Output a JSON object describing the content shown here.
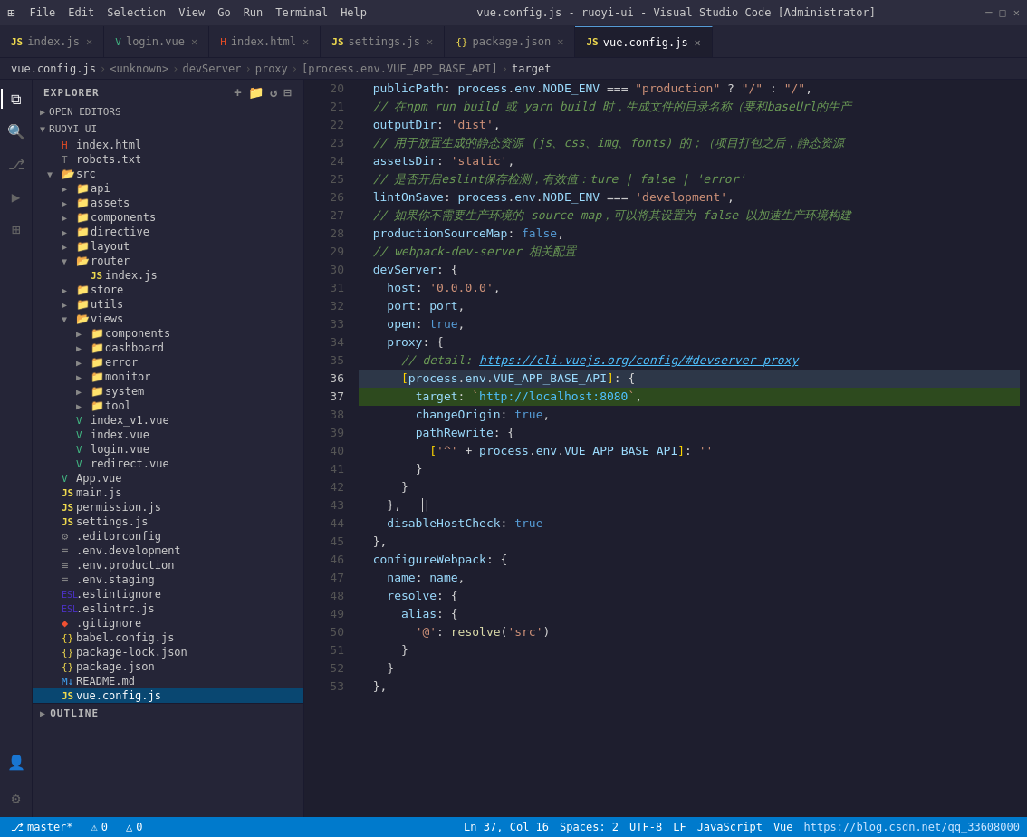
{
  "titlebar": {
    "title": "vue.config.js - ruoyi-ui - Visual Studio Code [Administrator]",
    "menus": [
      "File",
      "Edit",
      "Selection",
      "View",
      "Go",
      "Run",
      "Terminal",
      "Help"
    ]
  },
  "tabs": [
    {
      "id": "index-js",
      "label": "index.js",
      "icon": "JS",
      "icon_color": "#f0db4f",
      "active": false,
      "modified": false
    },
    {
      "id": "login-vue",
      "label": "login.vue",
      "icon": "V",
      "icon_color": "#42b883",
      "active": false,
      "modified": false
    },
    {
      "id": "index-html",
      "label": "index.html",
      "icon": "H",
      "icon_color": "#e34c26",
      "active": false,
      "modified": false
    },
    {
      "id": "settings-js",
      "label": "settings.js",
      "icon": "JS",
      "icon_color": "#f0db4f",
      "active": false,
      "modified": false
    },
    {
      "id": "package-json",
      "label": "package.json",
      "icon": "{}",
      "icon_color": "#f0db4f",
      "active": false,
      "modified": false
    },
    {
      "id": "vue-config-js",
      "label": "vue.config.js",
      "icon": "JS",
      "icon_color": "#f0db4f",
      "active": true,
      "modified": false
    }
  ],
  "breadcrumb": {
    "items": [
      "vue.config.js",
      "<unknown>",
      "devServer",
      "proxy",
      "[process.env.VUE_APP_BASE_API]",
      "target"
    ]
  },
  "sidebar": {
    "explorer_title": "EXPLORER",
    "open_editors_title": "OPEN EDITORS",
    "project_title": "RUOYI-UI",
    "items": [
      {
        "id": "index-html-root",
        "label": "index.html",
        "type": "html",
        "indent": 2,
        "icon": "html"
      },
      {
        "id": "robots-txt",
        "label": "robots.txt",
        "type": "txt",
        "indent": 2,
        "icon": "txt"
      },
      {
        "id": "src",
        "label": "src",
        "type": "folder",
        "indent": 2,
        "icon": "folder",
        "open": true
      },
      {
        "id": "api",
        "label": "api",
        "type": "folder",
        "indent": 3,
        "icon": "folder-closed"
      },
      {
        "id": "assets",
        "label": "assets",
        "type": "folder",
        "indent": 3,
        "icon": "folder-closed"
      },
      {
        "id": "components",
        "label": "components",
        "type": "folder",
        "indent": 3,
        "icon": "folder-closed"
      },
      {
        "id": "directive",
        "label": "directive",
        "type": "folder",
        "indent": 3,
        "icon": "folder-closed"
      },
      {
        "id": "layout",
        "label": "layout",
        "type": "folder",
        "indent": 3,
        "icon": "folder-closed"
      },
      {
        "id": "router",
        "label": "router",
        "type": "folder",
        "indent": 3,
        "icon": "folder-open",
        "open": true
      },
      {
        "id": "router-index-js",
        "label": "index.js",
        "type": "js",
        "indent": 4,
        "icon": "js"
      },
      {
        "id": "store",
        "label": "store",
        "type": "folder",
        "indent": 3,
        "icon": "folder-closed"
      },
      {
        "id": "utils",
        "label": "utils",
        "type": "folder",
        "indent": 3,
        "icon": "folder-closed"
      },
      {
        "id": "views",
        "label": "views",
        "type": "folder",
        "indent": 3,
        "icon": "folder-open",
        "open": true
      },
      {
        "id": "views-components",
        "label": "components",
        "type": "folder",
        "indent": 4,
        "icon": "folder-closed"
      },
      {
        "id": "views-dashboard",
        "label": "dashboard",
        "type": "folder",
        "indent": 4,
        "icon": "folder-closed"
      },
      {
        "id": "views-error",
        "label": "error",
        "type": "folder",
        "indent": 4,
        "icon": "folder-closed"
      },
      {
        "id": "views-monitor",
        "label": "monitor",
        "type": "folder",
        "indent": 4,
        "icon": "folder-closed"
      },
      {
        "id": "views-system",
        "label": "system",
        "type": "folder",
        "indent": 4,
        "icon": "folder-closed"
      },
      {
        "id": "views-tool",
        "label": "tool",
        "type": "folder",
        "indent": 4,
        "icon": "folder-closed"
      },
      {
        "id": "index-v1-vue",
        "label": "index_v1.vue",
        "type": "vue",
        "indent": 3,
        "icon": "vue"
      },
      {
        "id": "index-vue",
        "label": "index.vue",
        "type": "vue",
        "indent": 3,
        "icon": "vue"
      },
      {
        "id": "login-vue-src",
        "label": "login.vue",
        "type": "vue",
        "indent": 3,
        "icon": "vue"
      },
      {
        "id": "redirect-vue",
        "label": "redirect.vue",
        "type": "vue",
        "indent": 3,
        "icon": "vue"
      },
      {
        "id": "app-vue",
        "label": "App.vue",
        "type": "vue",
        "indent": 2,
        "icon": "vue"
      },
      {
        "id": "main-js",
        "label": "main.js",
        "type": "js",
        "indent": 2,
        "icon": "js"
      },
      {
        "id": "permission-js",
        "label": "permission.js",
        "type": "js",
        "indent": 2,
        "icon": "js"
      },
      {
        "id": "settings-js-src",
        "label": "settings.js",
        "type": "js",
        "indent": 2,
        "icon": "js"
      },
      {
        "id": "editorconfig",
        "label": ".editorconfig",
        "type": "config",
        "indent": 2,
        "icon": "gear"
      },
      {
        "id": "env-development",
        "label": ".env.development",
        "type": "env",
        "indent": 2,
        "icon": "env"
      },
      {
        "id": "env-production",
        "label": ".env.production",
        "type": "env",
        "indent": 2,
        "icon": "env"
      },
      {
        "id": "env-staging",
        "label": ".env.staging",
        "type": "env",
        "indent": 2,
        "icon": "env"
      },
      {
        "id": "eslintignore",
        "label": ".eslintignore",
        "type": "eslint",
        "indent": 2,
        "icon": "eslint"
      },
      {
        "id": "eslintrc-js",
        "label": ".eslintrc.js",
        "type": "js",
        "indent": 2,
        "icon": "eslint"
      },
      {
        "id": "gitignore",
        "label": ".gitignore",
        "type": "git",
        "indent": 2,
        "icon": "git"
      },
      {
        "id": "babel-config-js",
        "label": "babel.config.js",
        "type": "js",
        "indent": 2,
        "icon": "js"
      },
      {
        "id": "package-lock-json",
        "label": "package-lock.json",
        "type": "json",
        "indent": 2,
        "icon": "json"
      },
      {
        "id": "package-json-root",
        "label": "package.json",
        "type": "json",
        "indent": 2,
        "icon": "json"
      },
      {
        "id": "readme-md",
        "label": "README.md",
        "type": "md",
        "indent": 2,
        "icon": "md"
      },
      {
        "id": "vue-config-js-item",
        "label": "vue.config.js",
        "type": "js",
        "indent": 2,
        "icon": "js",
        "active": true
      }
    ],
    "outline_title": "OUTLINE"
  },
  "editor": {
    "filename": "vue.config.js",
    "lines": [
      {
        "num": 20,
        "content": "  publicPath: process.env.NODE_ENV === \"production\" ? \"/\" : \"/\",",
        "highlight": false
      },
      {
        "num": 21,
        "content": "  // 在npm run build 或 yarn build 时，生成文件的目录名称（要和baseUrl的生产",
        "highlight": false
      },
      {
        "num": 22,
        "content": "  outputDir: 'dist',",
        "highlight": false
      },
      {
        "num": 23,
        "content": "  // 用于放置生成的静态资源 (js、css、img、fonts) 的；（项目打包之后，静态资源",
        "highlight": false
      },
      {
        "num": 24,
        "content": "  assetsDir: 'static',",
        "highlight": false
      },
      {
        "num": 25,
        "content": "  // 是否开启eslint保存检测，有效值：ture | false | 'error'",
        "highlight": false
      },
      {
        "num": 26,
        "content": "  lintOnSave: process.env.NODE_ENV === 'development',",
        "highlight": false
      },
      {
        "num": 27,
        "content": "  // 如果你不需要生产环境的 source map，可以将其设置为 false 以加速生产环境构建",
        "highlight": false
      },
      {
        "num": 28,
        "content": "  productionSourceMap: false,",
        "highlight": false
      },
      {
        "num": 29,
        "content": "  // webpack-dev-server 相关配置",
        "highlight": false
      },
      {
        "num": 30,
        "content": "  devServer: {",
        "highlight": false
      },
      {
        "num": 31,
        "content": "    host: '0.0.0.0',",
        "highlight": false
      },
      {
        "num": 32,
        "content": "    port: port,",
        "highlight": false
      },
      {
        "num": 33,
        "content": "    open: true,",
        "highlight": false
      },
      {
        "num": 34,
        "content": "    proxy: {",
        "highlight": false
      },
      {
        "num": 35,
        "content": "      // detail: https://cli.vuejs.org/config/#devserver-proxy",
        "highlight": false
      },
      {
        "num": 36,
        "content": "      [process.env.VUE_APP_BASE_API]: {",
        "highlight": false
      },
      {
        "num": 37,
        "content": "        target: `http://localhost:8080`,",
        "highlight": true
      },
      {
        "num": 38,
        "content": "        changeOrigin: true,",
        "highlight": false
      },
      {
        "num": 39,
        "content": "        pathRewrite: {",
        "highlight": false
      },
      {
        "num": 40,
        "content": "          ['^' + process.env.VUE_APP_BASE_API]: ''",
        "highlight": false
      },
      {
        "num": 41,
        "content": "        }",
        "highlight": false
      },
      {
        "num": 42,
        "content": "      }",
        "highlight": false
      },
      {
        "num": 43,
        "content": "    },   |",
        "highlight": false
      },
      {
        "num": 44,
        "content": "    disableHostCheck: true",
        "highlight": false
      },
      {
        "num": 45,
        "content": "  },",
        "highlight": false
      },
      {
        "num": 46,
        "content": "  configureWebpack: {",
        "highlight": false
      },
      {
        "num": 47,
        "content": "    name: name,",
        "highlight": false
      },
      {
        "num": 48,
        "content": "    resolve: {",
        "highlight": false
      },
      {
        "num": 49,
        "content": "      alias: {",
        "highlight": false
      },
      {
        "num": 50,
        "content": "        '@': resolve('src')",
        "highlight": false
      },
      {
        "num": 51,
        "content": "      }",
        "highlight": false
      },
      {
        "num": 52,
        "content": "    }",
        "highlight": false
      },
      {
        "num": 53,
        "content": "  },",
        "highlight": false
      }
    ]
  },
  "statusbar": {
    "left_items": [
      "⎇ master*",
      "⚠ 0",
      "△ 0"
    ],
    "right_items": [
      "Ln 37, Col 16",
      "Spaces: 2",
      "UTF-8",
      "LF",
      "JavaScript",
      "Vue",
      "https://blog.csdn.net/qq_33608000"
    ]
  }
}
